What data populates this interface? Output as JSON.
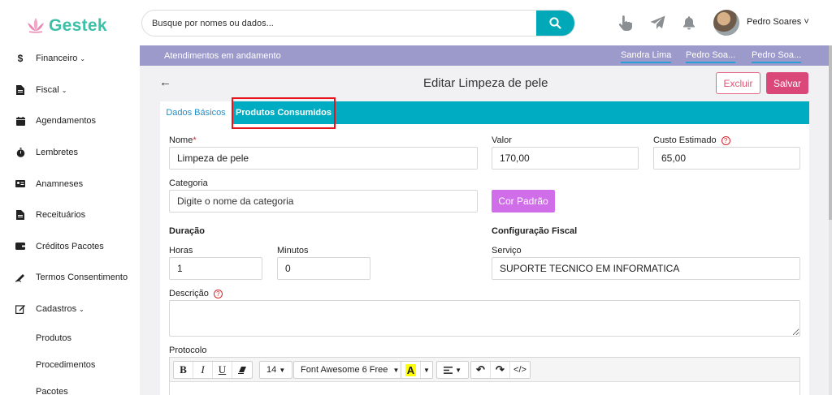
{
  "brand": {
    "name": "Gestek"
  },
  "search": {
    "placeholder": "Busque por nomes ou dados..."
  },
  "user": {
    "name": "Pedro Soares ˅"
  },
  "sidebar": {
    "items": [
      {
        "label": "Financeiro",
        "icon": "dollar-icon",
        "expandable": true
      },
      {
        "label": "Fiscal",
        "icon": "document-icon",
        "expandable": true
      },
      {
        "label": "Agendamentos",
        "icon": "calendar-icon",
        "expandable": false
      },
      {
        "label": "Lembretes",
        "icon": "stopwatch-icon",
        "expandable": false
      },
      {
        "label": "Anamneses",
        "icon": "id-card-icon",
        "expandable": false
      },
      {
        "label": "Receituários",
        "icon": "file-icon",
        "expandable": false
      },
      {
        "label": "Créditos Pacotes",
        "icon": "wallet-icon",
        "expandable": false
      },
      {
        "label": "Termos Consentimento",
        "icon": "signature-icon",
        "expandable": false
      },
      {
        "label": "Cadastros",
        "icon": "edit-icon",
        "expandable": true
      }
    ],
    "subitems": [
      "Produtos",
      "Procedimentos",
      "Pacotes"
    ]
  },
  "subbar": {
    "title": "Atendimentos em andamento",
    "tags": [
      "Sandra Lima",
      "Pedro Soa...",
      "Pedro Soa..."
    ]
  },
  "header": {
    "title": "Editar Limpeza de pele",
    "delete_label": "Excluir",
    "save_label": "Salvar"
  },
  "tabs": [
    "Dados Básicos",
    "Produtos Consumidos"
  ],
  "form": {
    "nome_label": "Nome",
    "nome_required": "*",
    "nome_value": "Limpeza de pele",
    "valor_label": "Valor",
    "valor_value": "170,00",
    "custo_label": "Custo Estimado",
    "custo_value": "65,00",
    "categoria_label": "Categoria",
    "categoria_placeholder": "Digite o nome da categoria",
    "cor_label": "Cor Padrão",
    "duracao_section": "Duração",
    "horas_label": "Horas",
    "horas_value": "1",
    "minutos_label": "Minutos",
    "minutos_value": "0",
    "fiscal_section": "Configuração Fiscal",
    "servico_label": "Serviço",
    "servico_value": "SUPORTE TECNICO EM INFORMATICA",
    "descricao_label": "Descrição",
    "protocolo_label": "Protocolo",
    "help_glyph": "?"
  },
  "editor": {
    "bold": "B",
    "italic": "I",
    "underline": "U",
    "font_size": "14",
    "font_family": "Font Awesome 6 Free",
    "color_letter": "A",
    "code": "</>"
  },
  "colors": {
    "accent": "#00acc1",
    "danger": "#d94878",
    "subbar": "#9c9acb",
    "cor_padrao": "#cf6ee8",
    "brand": "#3dbfa8"
  }
}
